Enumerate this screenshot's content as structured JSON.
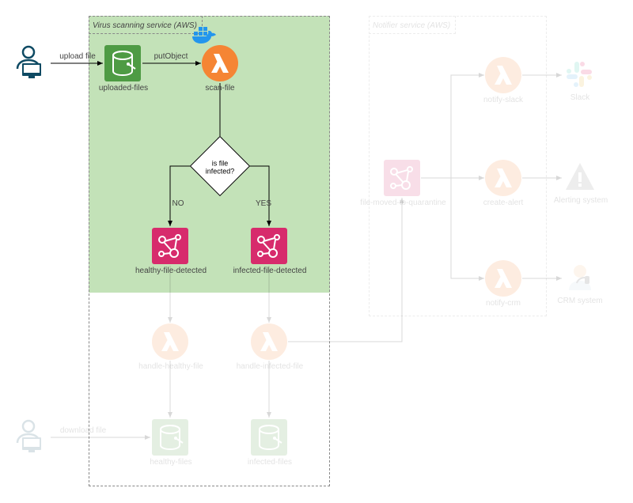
{
  "services": {
    "scanning_title": "Virus scanning service (AWS)",
    "notifier_title": "Notifier service (AWS)"
  },
  "actors": {
    "uploader_action": "upload file",
    "downloader_action": "download file"
  },
  "nodes": {
    "uploaded_files": "uploaded-files",
    "scan_file": "scan-file",
    "put_object": "putObject",
    "decision": "is file infected?",
    "no": "NO",
    "yes": "YES",
    "healthy_detected": "healthy-file-detected",
    "infected_detected": "infected-file-detected",
    "handle_healthy": "handle-healthy-file",
    "handle_infected": "handle-infected-file",
    "healthy_files": "healthy-files",
    "infected_files": "infected-files",
    "file_moved": "file-moved-to-quarantine",
    "notify_slack": "notify-slack",
    "create_alert": "create-alert",
    "notify_crm": "notify-crm",
    "slack": "Slack",
    "alerting": "Alerting system",
    "crm": "CRM system"
  },
  "colors": {
    "s3": "#4e9b44",
    "lambda": "#f58534",
    "sns": "#d72b6c",
    "user": "#0e4a63",
    "highlight_bg": "#c3e2b8",
    "docker": "#2396ed"
  }
}
